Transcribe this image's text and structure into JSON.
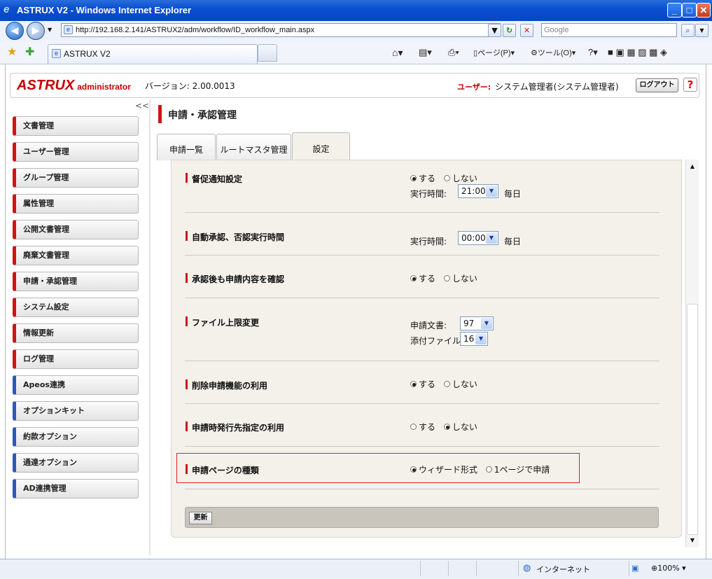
{
  "window": {
    "title": "ASTRUX V2 - Windows Internet Explorer"
  },
  "browser": {
    "url": "http://192.168.2.141/ASTRUX2/adm/workflow/ID_workflow_main.aspx",
    "search_placeholder": "Google",
    "tab_title": "ASTRUX V2",
    "toolbar": {
      "page_menu": "ページ(P)",
      "tools_menu": "ツール(O)"
    }
  },
  "header": {
    "logo": "ASTRUX",
    "logo_sub": "administrator",
    "version": "バージョン: 2.00.0013",
    "user_label": "ユーザー:",
    "user_name": "システム管理者(システム管理者)",
    "logout_label": "ログアウト",
    "help_label": "?"
  },
  "sidebar": {
    "collapse_label": "<<",
    "items": [
      {
        "label": "文書管理",
        "color": "#cc1515"
      },
      {
        "label": "ユーザー管理",
        "color": "#cc1515"
      },
      {
        "label": "グループ管理",
        "color": "#cc1515"
      },
      {
        "label": "属性管理",
        "color": "#cc1515"
      },
      {
        "label": "公開文書管理",
        "color": "#cc1515"
      },
      {
        "label": "廃棄文書管理",
        "color": "#cc1515"
      },
      {
        "label": "申請・承認管理",
        "color": "#cc1515"
      },
      {
        "label": "システム設定",
        "color": "#cc1515"
      },
      {
        "label": "情報更新",
        "color": "#cc1515"
      },
      {
        "label": "ログ管理",
        "color": "#cc1515"
      },
      {
        "label": "Apeos連携",
        "color": "#2d57b8"
      },
      {
        "label": "オプションキット",
        "color": "#2d57b8"
      },
      {
        "label": "約款オプション",
        "color": "#2d57b8"
      },
      {
        "label": "通達オプション",
        "color": "#2d57b8"
      },
      {
        "label": "AD連携管理",
        "color": "#2d57b8"
      }
    ]
  },
  "main": {
    "title": "申請・承認管理",
    "tabs": [
      {
        "label": "申請一覧",
        "active": false
      },
      {
        "label": "ルートマスタ管理",
        "active": false
      },
      {
        "label": "設定",
        "active": true
      }
    ],
    "settings": {
      "reminder": {
        "label": "督促通知設定",
        "opt_yes": "する",
        "opt_no": "しない",
        "selected": "yes",
        "time_label": "実行時間:",
        "time_value": "21:00",
        "every_day": "毎日"
      },
      "auto_approve": {
        "label": "自動承認、否認実行時間",
        "time_label": "実行時間:",
        "time_value": "00:00",
        "every_day": "毎日"
      },
      "confirm_after": {
        "label": "承認後も申請内容を確認",
        "opt_yes": "する",
        "opt_no": "しない",
        "selected": "yes"
      },
      "file_limit": {
        "label": "ファイル上限変更",
        "doc_label": "申請文書:",
        "doc_value": "97",
        "attach_label": "添付ファイル:",
        "attach_value": "16"
      },
      "delete_request": {
        "label": "削除申請機能の利用",
        "opt_yes": "する",
        "opt_no": "しない",
        "selected": "yes"
      },
      "dest_specify": {
        "label": "申請時発行先指定の利用",
        "opt_yes": "する",
        "opt_no": "しない",
        "selected": "no"
      },
      "page_type": {
        "label": "申請ページの種類",
        "opt_wizard": "ウィザード形式",
        "opt_single": "1ページで申請",
        "selected": "wizard"
      }
    },
    "update_label": "更新"
  },
  "statusbar": {
    "zone": "インターネット",
    "zoom": "100%"
  },
  "colors": {
    "accent": "#cc1515",
    "option_blue": "#2d57b8",
    "highlight_border": "#e2231a"
  }
}
